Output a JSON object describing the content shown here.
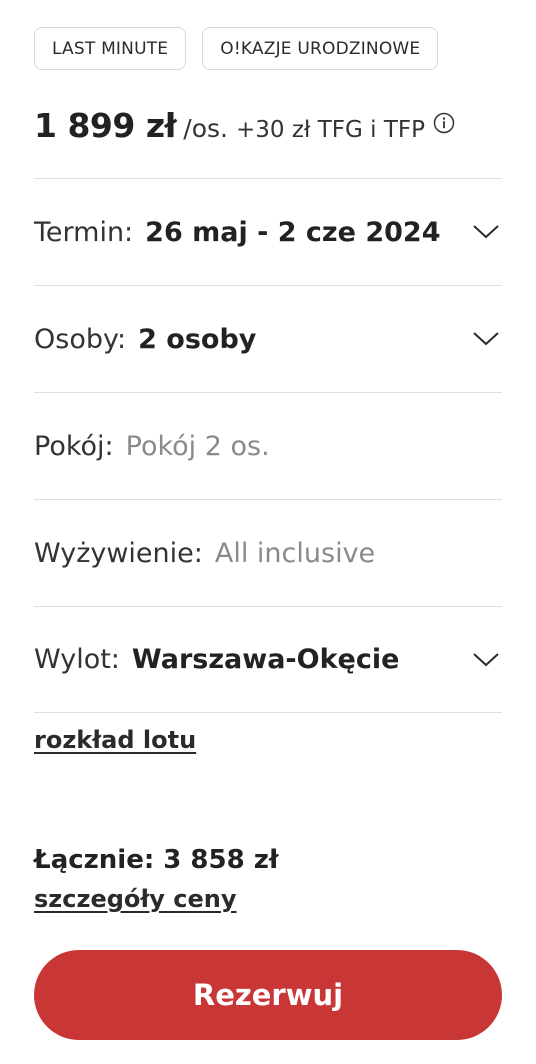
{
  "tags": [
    "LAST MINUTE",
    "O!KAZJE URODZINOWE"
  ],
  "price": {
    "amount": "1 899 zł",
    "unit": "/os.",
    "extra": "+30 zł TFG i TFP",
    "info_icon": "info-circle-icon"
  },
  "rows": {
    "termin": {
      "label": "Termin:",
      "value": "26 maj - 2 cze 2024"
    },
    "osoby": {
      "label": "Osoby:",
      "value": "2 osoby"
    },
    "pokoj": {
      "label": "Pokój:",
      "value": "Pokój 2 os."
    },
    "wyzywienie": {
      "label": "Wyżywienie:",
      "value": "All inclusive"
    },
    "wylot": {
      "label": "Wylot:",
      "value": "Warszawa-Okęcie"
    }
  },
  "links": {
    "flight_schedule": "rozkład lotu",
    "price_details": "szczegóły ceny"
  },
  "total": "Łącznie: 3 858 zł",
  "book_button": "Rezerwuj",
  "colors": {
    "accent": "#c83636",
    "divider": "#dedede",
    "muted_text": "#8a8a8a"
  }
}
